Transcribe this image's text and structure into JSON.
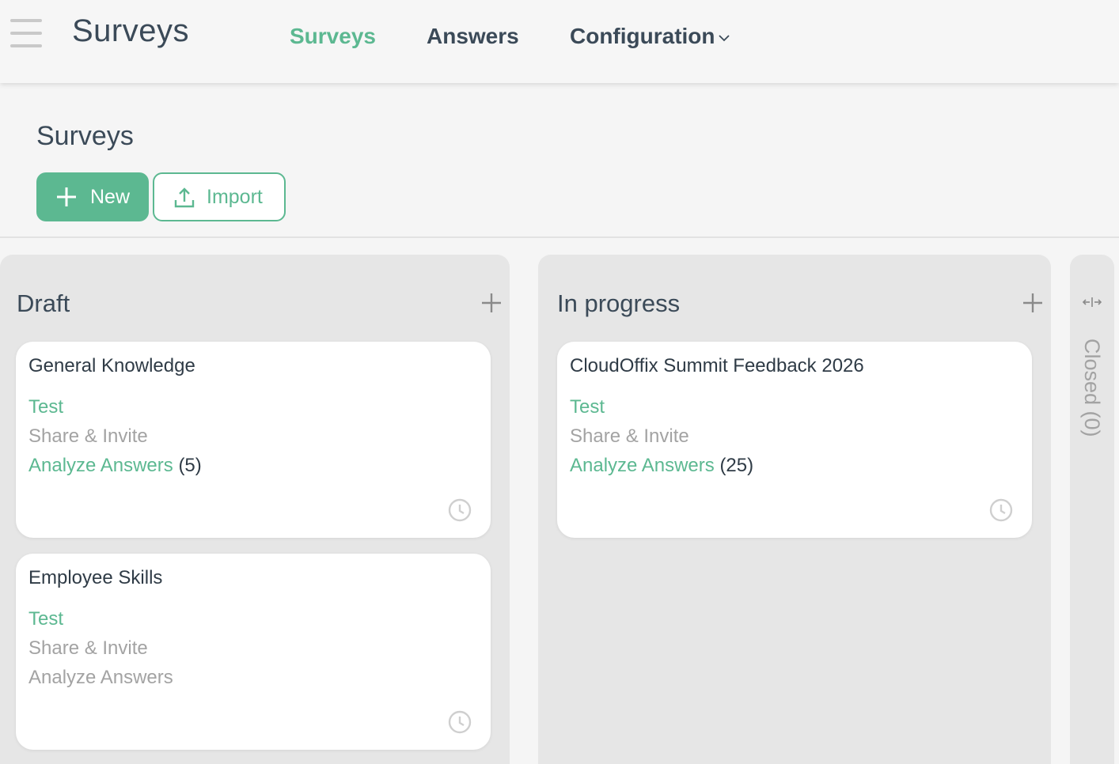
{
  "app": {
    "title": "Surveys"
  },
  "nav": {
    "items": [
      {
        "label": "Surveys",
        "active": true
      },
      {
        "label": "Answers",
        "active": false
      },
      {
        "label": "Configuration",
        "active": false
      }
    ]
  },
  "control_panel": {
    "breadcrumb": "Surveys",
    "new_label": "New",
    "import_label": "Import"
  },
  "colors": {
    "accent": "#5cb891",
    "text": "#3b4a58",
    "muted": "#a3a3a3",
    "column_bg": "#e6e6e6"
  },
  "icons": {
    "menu": "hamburger-icon",
    "dropdown": "chevron-down-icon",
    "new": "plus-icon",
    "import": "upload-icon",
    "add_card": "plus-icon",
    "activity": "clock-icon",
    "expand": "expand-horizontal-icon"
  },
  "columns": [
    {
      "title": "Draft",
      "cards": [
        {
          "name": "General Knowledge",
          "test": "Test",
          "share": "Share & Invite",
          "analyze": "Analyze Answers",
          "count": "(5)"
        },
        {
          "name": "Employee Skills",
          "test": "Test",
          "share": "Share & Invite",
          "analyze": "Analyze Answers",
          "count": ""
        }
      ]
    },
    {
      "title": "In progress",
      "cards": [
        {
          "name": "CloudOffix Summit Feedback 2026",
          "test": "Test",
          "share": "Share & Invite",
          "analyze": "Analyze Answers",
          "count": "(25)"
        }
      ]
    },
    {
      "title": "Closed (0)",
      "folded": true,
      "cards": []
    }
  ]
}
